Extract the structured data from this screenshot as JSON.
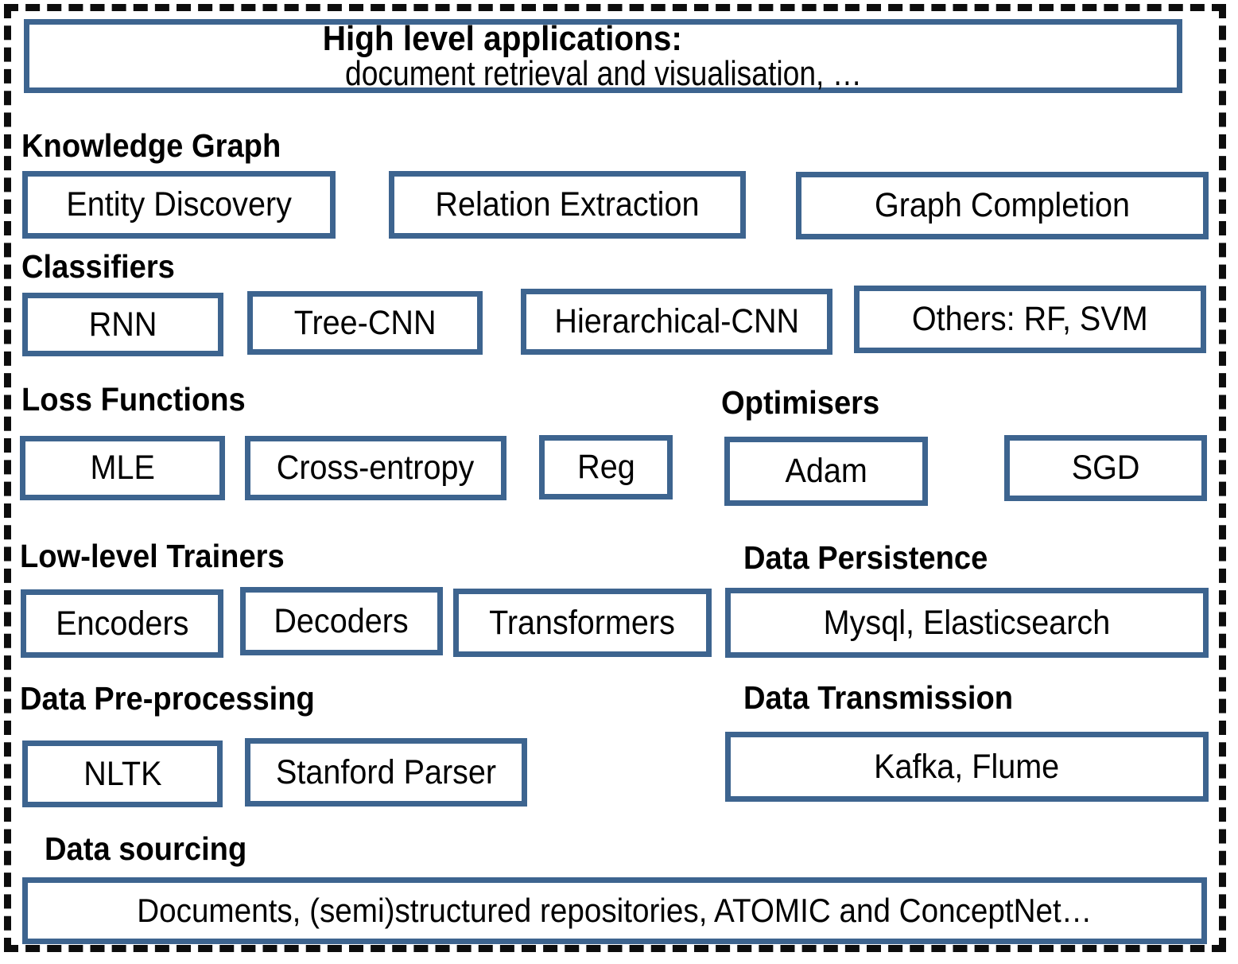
{
  "diagram": {
    "title_box": {
      "bold_prefix": "High level applications:",
      "rest": " document retrieval and visualisation, …",
      "full": "High level applications: document retrieval and visualisation, …"
    },
    "frame_style": "dashed",
    "accent_color": "#3d648f",
    "frame_color": "#0d0d0d",
    "sections": [
      {
        "heading": "Knowledge Graph",
        "items": [
          "Entity Discovery",
          "Relation Extraction",
          "Graph Completion"
        ]
      },
      {
        "heading": "Classifiers",
        "items": [
          "RNN",
          "Tree-CNN",
          "Hierarchical-CNN",
          "Others: RF, SVM"
        ]
      },
      {
        "heading": "Loss Functions",
        "items": [
          "MLE",
          "Cross-entropy",
          "Reg"
        ]
      },
      {
        "heading": "Optimisers",
        "items": [
          "Adam",
          "SGD"
        ]
      },
      {
        "heading": "Low-level Trainers",
        "items": [
          "Encoders",
          "Decoders",
          "Transformers"
        ]
      },
      {
        "heading": "Data Persistence",
        "items": [
          "Mysql, Elasticsearch"
        ]
      },
      {
        "heading": "Data Pre-processing",
        "items": [
          "NLTK",
          "Stanford Parser"
        ]
      },
      {
        "heading": "Data Transmission",
        "items": [
          "Kafka, Flume"
        ]
      },
      {
        "heading": "Data sourcing",
        "items": [
          "Documents, (semi)structured repositories, ATOMIC and ConceptNet…"
        ]
      }
    ]
  }
}
